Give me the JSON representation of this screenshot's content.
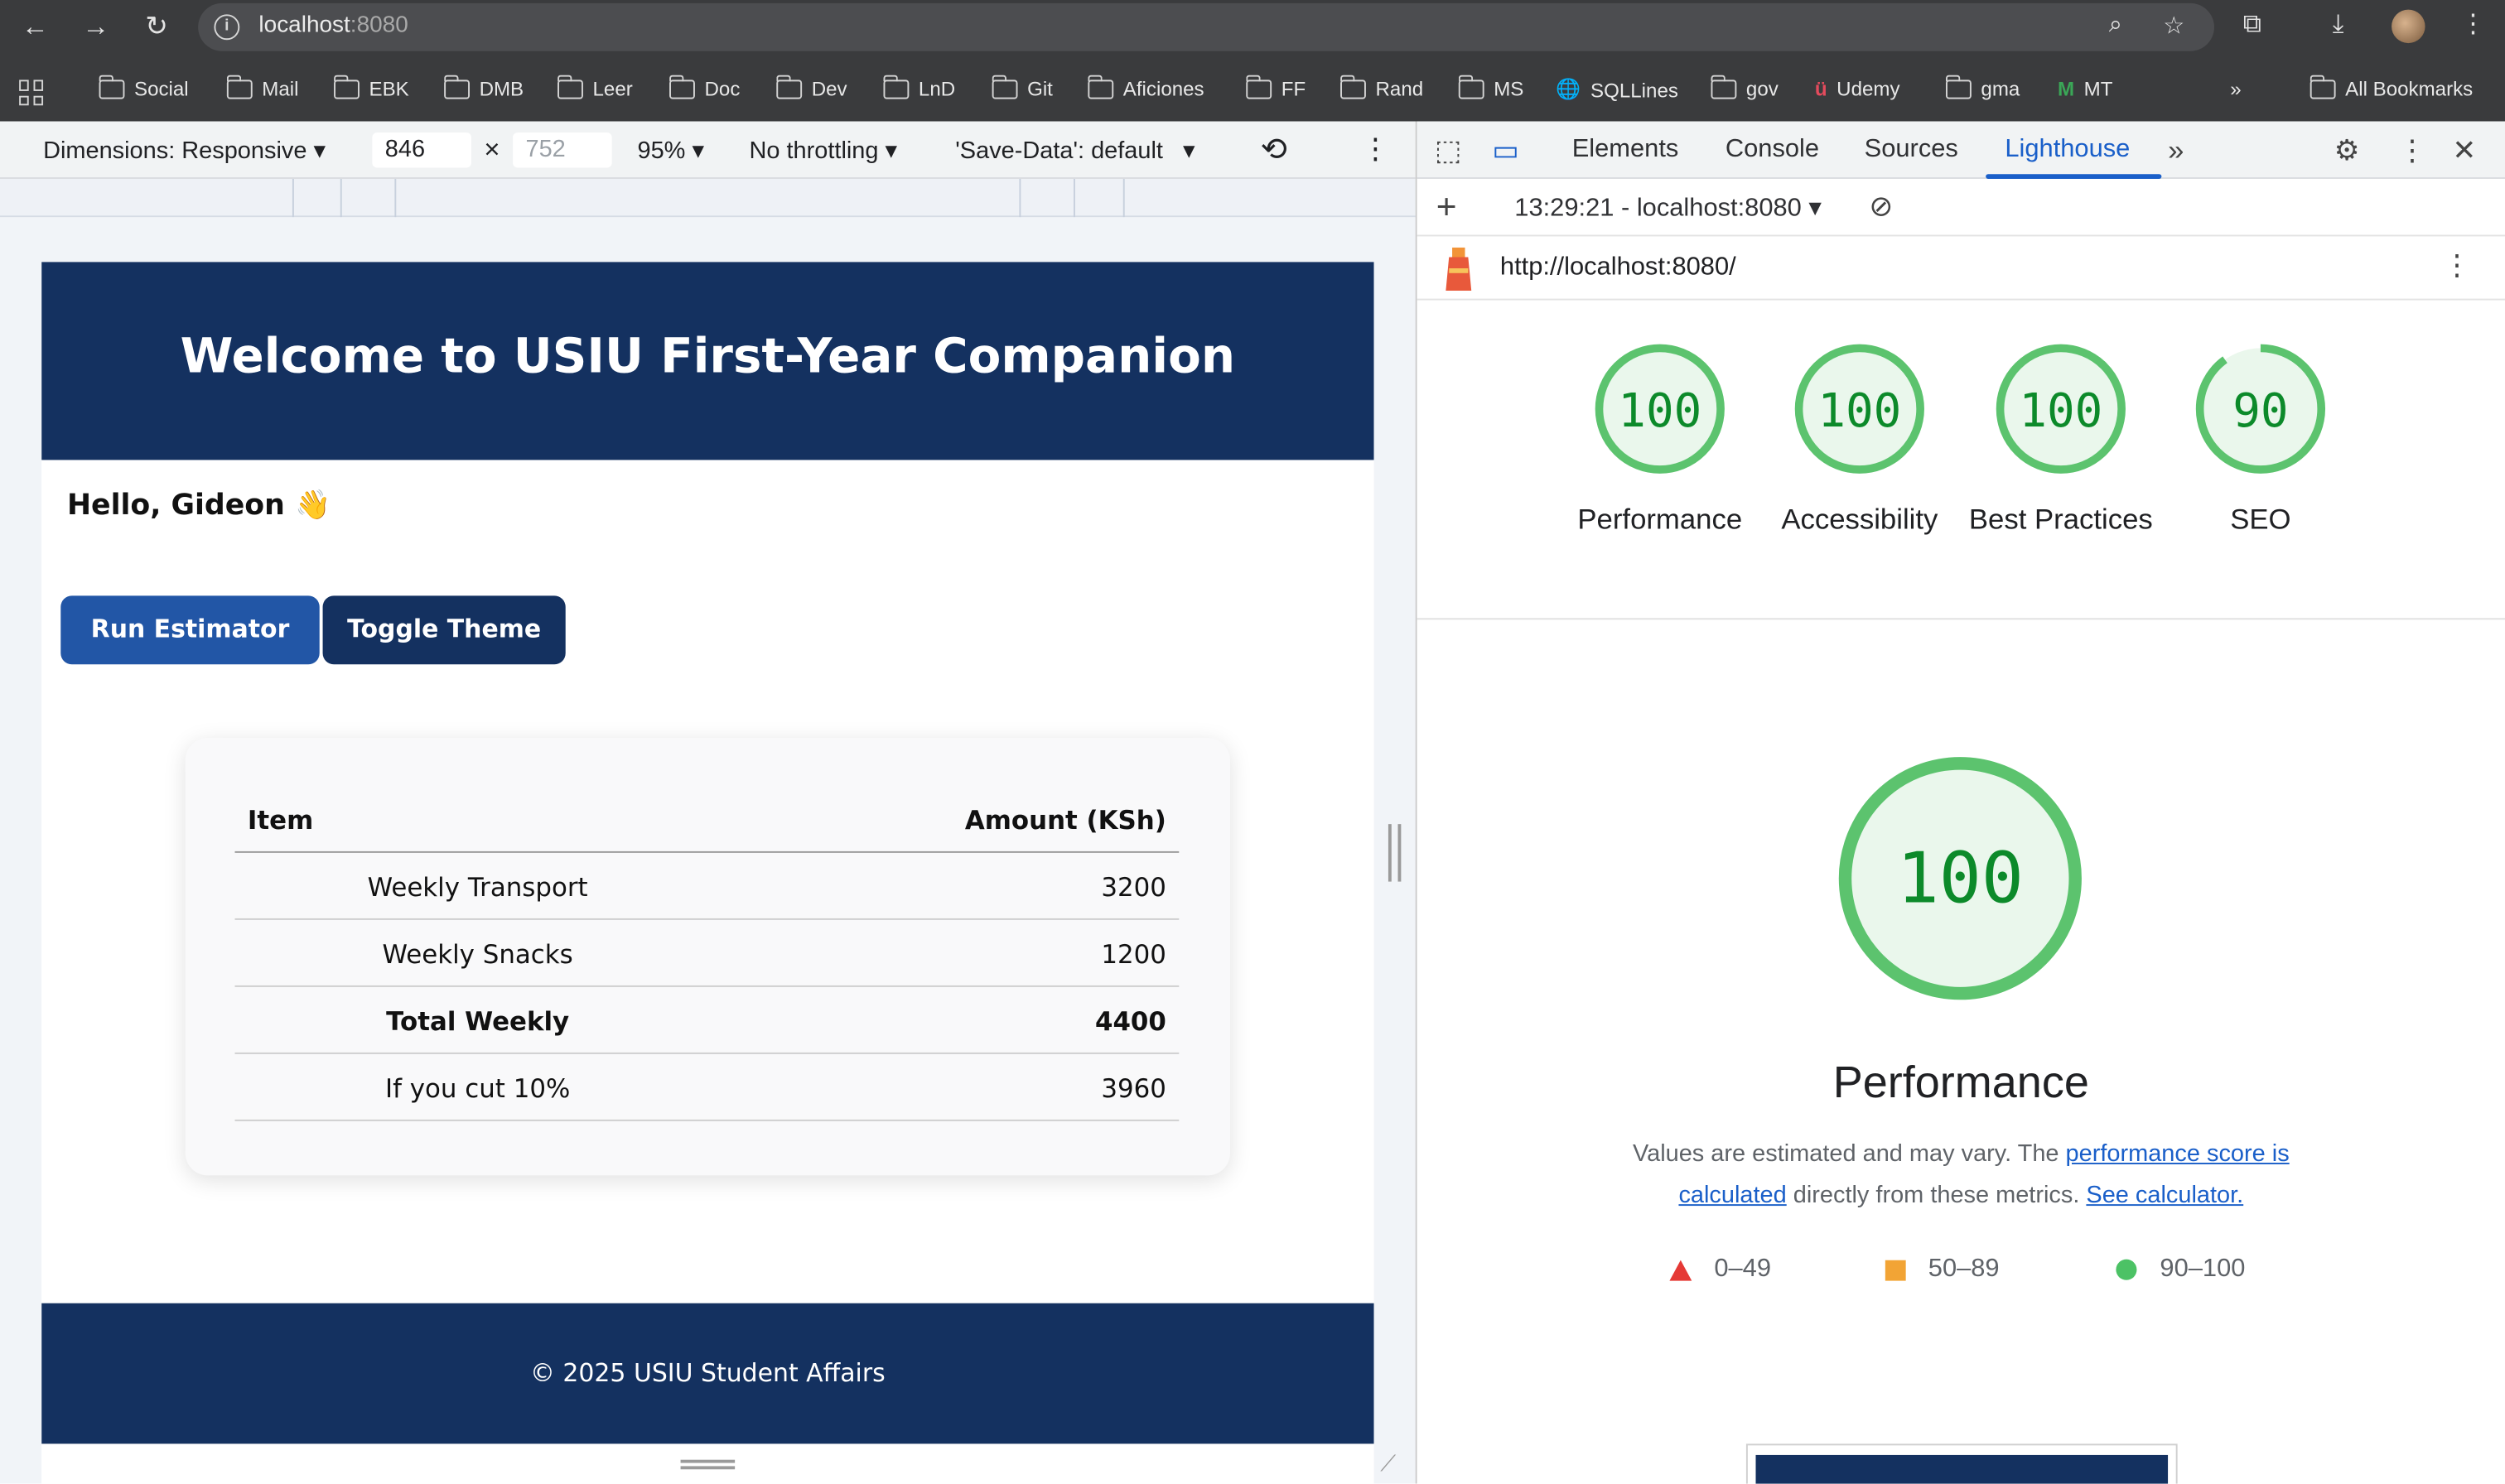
{
  "browser": {
    "url_host": "localhost",
    "url_port": ":8080",
    "bookmarks": [
      "Social",
      "Mail",
      "EBK",
      "DMB",
      "Leer",
      "Doc",
      "Dev",
      "LnD",
      "Git",
      "Aficiones",
      "FF",
      "Rand",
      "MS",
      "SQLLines",
      "gov",
      "Udemy",
      "gma",
      "MT"
    ],
    "all_bookmarks": "All Bookmarks",
    "overflow": "»"
  },
  "device_toolbar": {
    "dimensions": "Dimensions: Responsive",
    "width": "846",
    "height": "752",
    "times": "×",
    "zoom": "95%",
    "throttling": "No throttling",
    "save_data": "'Save-Data': default"
  },
  "page": {
    "title": "Welcome to USIU First-Year Companion",
    "greeting": "Hello, Gideon 👋",
    "run_button": "Run Estimator",
    "theme_button": "Toggle Theme",
    "table": {
      "headers": [
        "Item",
        "Amount (KSh)"
      ],
      "rows": [
        {
          "item": "Weekly Transport",
          "amount": "3200"
        },
        {
          "item": "Weekly Snacks",
          "amount": "1200"
        },
        {
          "item": "Total Weekly",
          "amount": "4400"
        },
        {
          "item": "If you cut 10%",
          "amount": "3960"
        }
      ]
    },
    "footer": "© 2025 USIU Student Affairs"
  },
  "devtools": {
    "tabs": [
      "Elements",
      "Console",
      "Sources",
      "Lighthouse"
    ],
    "active_tab": "Lighthouse",
    "report_selector": "13:29:21 - localhost:8080",
    "report_url": "http://localhost:8080/",
    "scores": [
      {
        "label": "Performance",
        "value": "100"
      },
      {
        "label": "Accessibility",
        "value": "100"
      },
      {
        "label": "Best Practices",
        "value": "100"
      },
      {
        "label": "SEO",
        "value": "90"
      }
    ],
    "score_fractions": [
      1.0,
      1.0,
      1.0,
      0.9
    ],
    "main_score": "100",
    "main_label": "Performance",
    "desc_prefix": "Values are estimated and may vary. The ",
    "desc_link1": "performance score is calculated",
    "desc_middle": " directly from these metrics. ",
    "desc_link2": "See calculator.",
    "legend": [
      "0–49",
      "50–89",
      "90–100"
    ],
    "colors": {
      "pass": "#0c8a2a",
      "pass_ring": "#5cc36e",
      "pass_fill": "#eaf7ec",
      "average": "#f2a435",
      "fail": "#e53935",
      "accent": "#1a5fc9"
    }
  }
}
